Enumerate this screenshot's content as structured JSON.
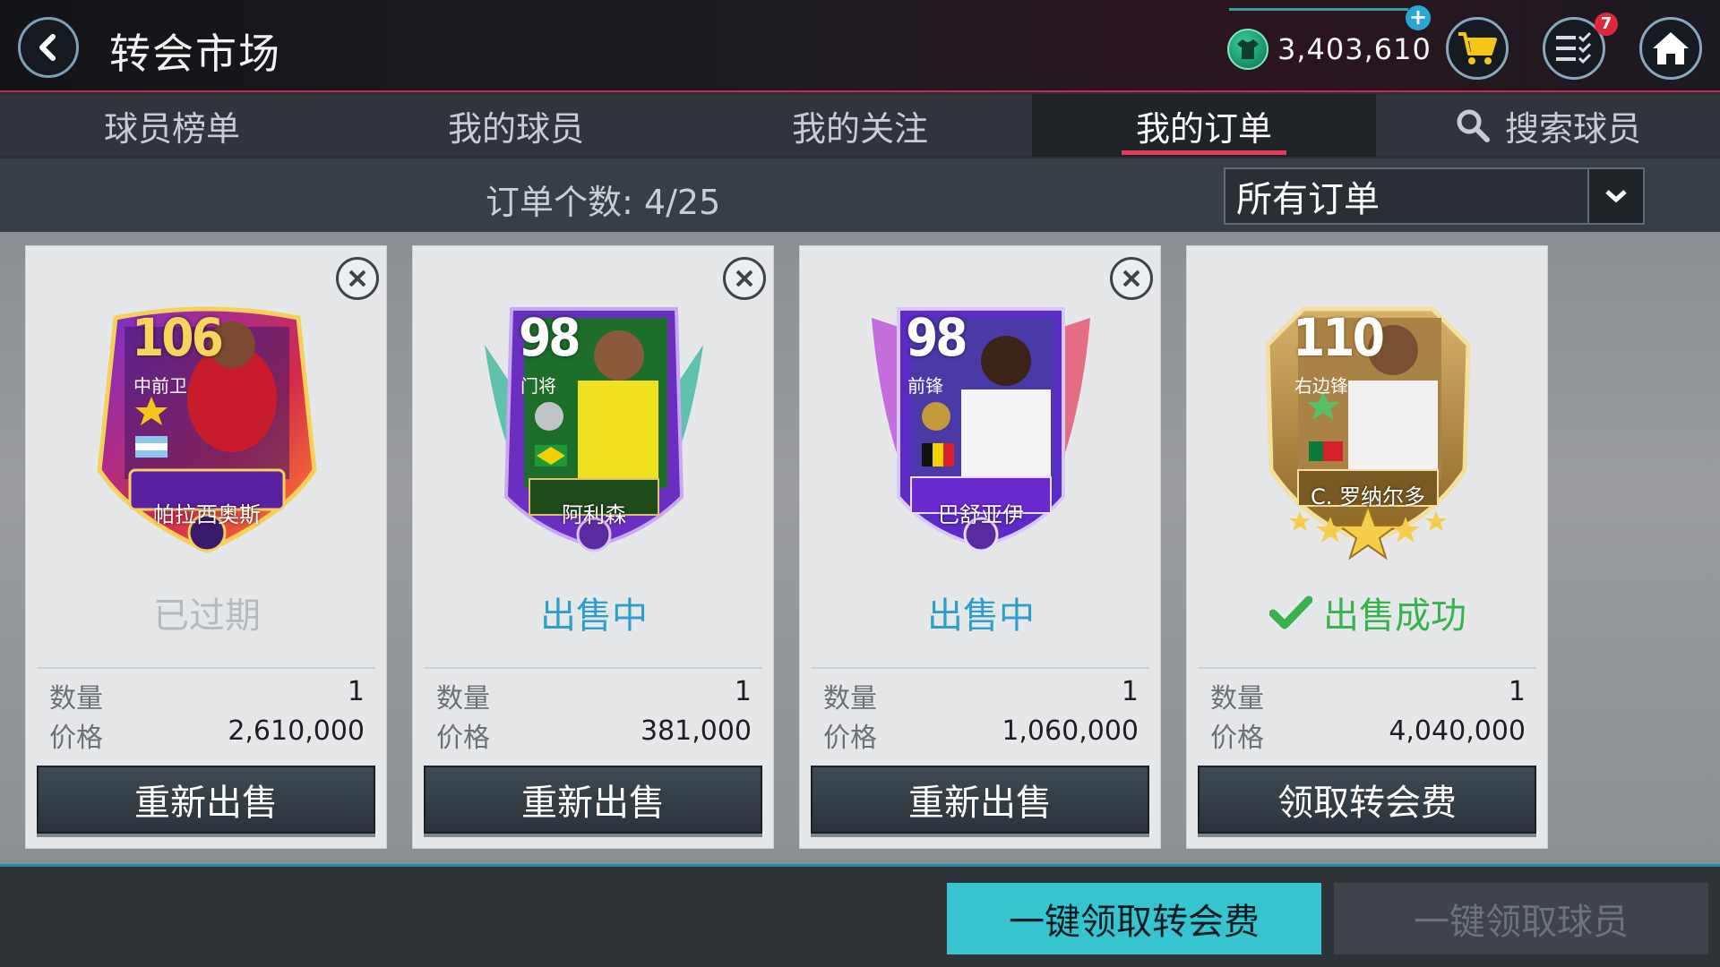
{
  "header": {
    "title": "转会市场",
    "currency_value": "3,403,610",
    "notification_count": "7"
  },
  "tabs": [
    {
      "label": "球员榜单",
      "active": false
    },
    {
      "label": "我的球员",
      "active": false
    },
    {
      "label": "我的关注",
      "active": false
    },
    {
      "label": "我的订单",
      "active": true
    },
    {
      "label": "搜索球员",
      "active": false
    }
  ],
  "subheader": {
    "order_count_label": "订单个数:",
    "order_count_value": "4/25",
    "filter_value": "所有订单"
  },
  "labels": {
    "quantity": "数量",
    "price": "价格"
  },
  "orders": [
    {
      "rating": "106",
      "position": "中前卫",
      "player_name": "帕拉西奥斯",
      "status": "已过期",
      "quantity": "1",
      "price": "2,610,000",
      "action": "重新出售"
    },
    {
      "rating": "98",
      "position": "门将",
      "player_name": "阿利森",
      "status": "出售中",
      "quantity": "1",
      "price": "381,000",
      "action": "重新出售"
    },
    {
      "rating": "98",
      "position": "前锋",
      "player_name": "巴舒亚伊",
      "status": "出售中",
      "quantity": "1",
      "price": "1,060,000",
      "action": "重新出售"
    },
    {
      "rating": "110",
      "position": "右边锋",
      "player_name": "C. 罗纳尔多",
      "status": "出售成功",
      "quantity": "1",
      "price": "4,040,000",
      "action": "领取转会费"
    }
  ],
  "bottom": {
    "claim_all_fees": "一键领取转会费",
    "claim_all_players": "一键领取球员"
  },
  "colors": {
    "accent_pink": "#e43a5e",
    "selling_blue": "#2e9fcb",
    "sold_green": "#37b24d",
    "primary_button": "#35c4d0"
  }
}
